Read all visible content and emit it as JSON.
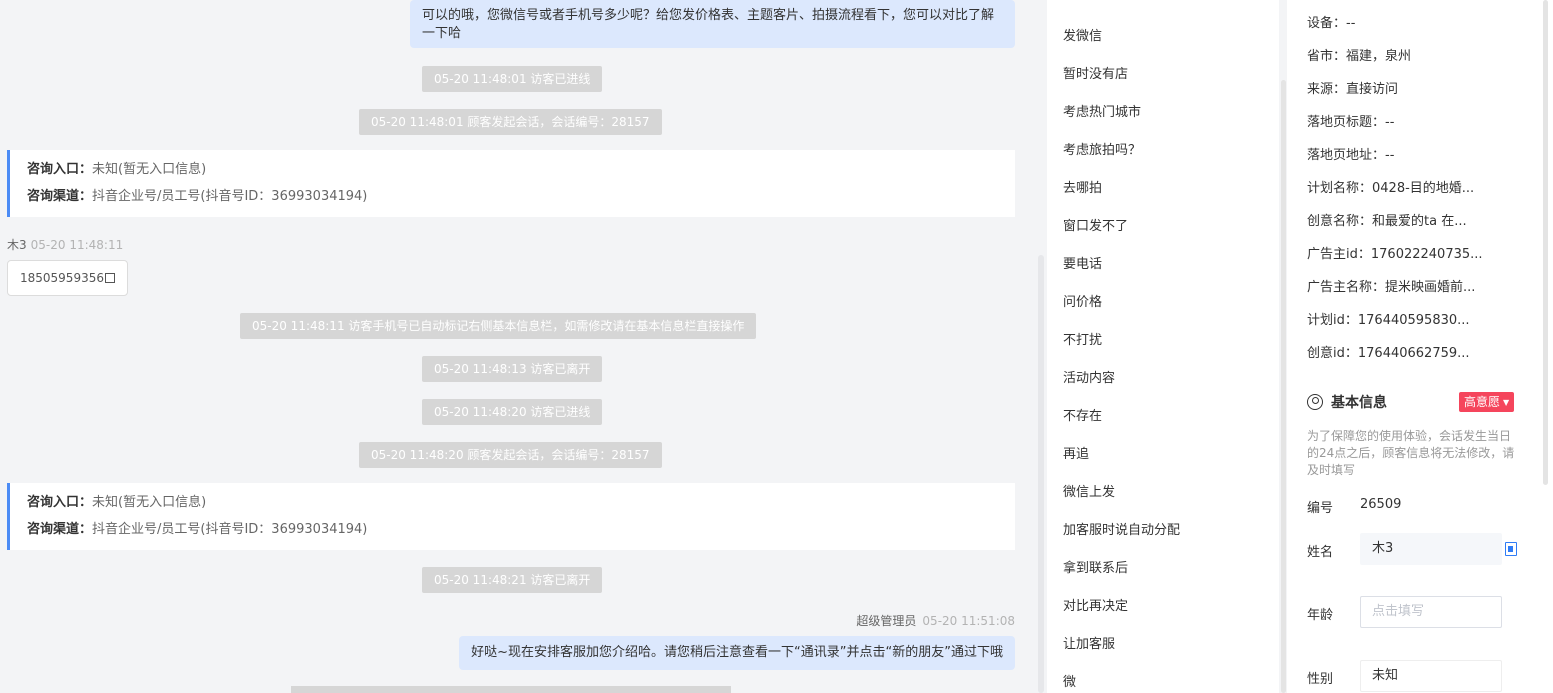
{
  "chat": {
    "top_agent_message": "可以的哦，您微信号或者手机号多少呢？给您发价格表、主题客片、拍摄流程看下，您可以对比了解一下哈",
    "events": [
      "05-20 11:48:01 访客已进线",
      "05-20 11:48:01 顾客发起会话，会话编号：28157",
      "05-20 11:48:11 访客手机号已自动标记右侧基本信息栏，如需修改请在基本信息栏直接操作",
      "05-20 11:48:13 访客已离开",
      "05-20 11:48:20 访客已进线",
      "05-20 11:48:20 顾客发起会话，会话编号：28157",
      "05-20 11:48:21 访客已离开"
    ],
    "info_card": {
      "entry_label": "咨询入口：",
      "entry_value": "未知(暂无入口信息)",
      "channel_label": "咨询渠道：",
      "channel_value": "抖音企业号/员工号(抖音号ID：36993034194)"
    },
    "visitor_name": "木3",
    "visitor_time": "05-20 11:48:11",
    "visitor_phone": "18505959356",
    "agent_name": "超级管理员",
    "agent_time": "05-20 11:51:08",
    "agent_message": "好哒~现在安排客服加您介绍哈。请您稍后注意查看一下“通讯录”并点击“新的朋友”通过下哦"
  },
  "quick_replies": [
    "发微信",
    "暂时没有店",
    "考虑热门城市",
    "考虑旅拍吗？",
    "去哪拍",
    "窗口发不了",
    "要电话",
    "问价格",
    "不打扰",
    "活动内容",
    "不存在",
    "再追",
    "微信上发",
    "加客服时说自动分配",
    "拿到联系后",
    "对比再决定",
    "让加客服",
    "微"
  ],
  "panel": {
    "details": [
      {
        "label": "设备：",
        "value": "--"
      },
      {
        "label": "省市：",
        "value": "福建，泉州"
      },
      {
        "label": "来源：",
        "value": "直接访问"
      },
      {
        "label": "落地页标题：",
        "value": "--"
      },
      {
        "label": "落地页地址：",
        "value": "--"
      },
      {
        "label": "计划名称：",
        "value": "0428-目的地婚..."
      },
      {
        "label": "创意名称：",
        "value": "和最爱的ta 在..."
      },
      {
        "label": "广告主id：",
        "value": "17602224073​5..."
      },
      {
        "label": "广告主名称：",
        "value": "提米映画婚前..."
      },
      {
        "label": "计划id：",
        "value": "176440595830..."
      },
      {
        "label": "创意id：",
        "value": "176440662759..."
      }
    ],
    "section_title": "基本信息",
    "intent_badge": "高意愿",
    "notice": "为了保障您的使用体验，会话发生当日的24点之后，顾客信息将无法修改，请及时填写",
    "id_label": "编号",
    "id_value": "26509",
    "name_label": "姓名",
    "name_value": "木3",
    "age_label": "年龄",
    "age_placeholder": "点击填写",
    "gender_label": "性别",
    "gender_value": "未知"
  },
  "colors": {
    "agent_bubble": "#dce8fd",
    "system_pill": "#d6d6d6",
    "card_accent": "#4b8bf5",
    "badge": "#f5455c",
    "link_blue": "#2f7cf6"
  }
}
